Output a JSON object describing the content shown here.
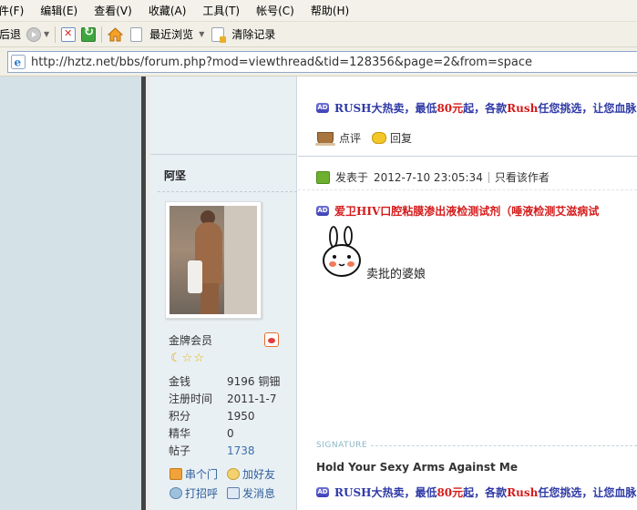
{
  "menu": [
    "件(F)",
    "编辑(E)",
    "查看(V)",
    "收藏(A)",
    "工具(T)",
    "帐号(C)",
    "帮助(H)"
  ],
  "toolbar": {
    "back_label": "后退",
    "recent_label": "最近浏览",
    "clear_label": "清除记录"
  },
  "address": {
    "url": "http://hztz.net/bbs/forum.php?mod=viewthread&tid=128356&page=2&from=space"
  },
  "top_ad": {
    "p1": "RUSH大热卖，最低",
    "p2": "80元",
    "p3": "起，各款",
    "p4": "Rush",
    "p5": "任您挑选，让您血脉"
  },
  "actions": {
    "rate_label": "点评",
    "reply_label": "回复"
  },
  "post": {
    "author": "阿坚",
    "posted_prefix": "发表于",
    "posted_time": "2012-7-10 23:05:34",
    "only_author": "只看该作者"
  },
  "post_ad": {
    "text": "爱卫HIV口腔粘膜渗出液检测试剂（唾液检测艾滋病试"
  },
  "profile": {
    "rank": "金牌会员",
    "stats": [
      {
        "label": "金钱",
        "value": "9196 铜钿"
      },
      {
        "label": "注册时间",
        "value": "2011-1-7"
      },
      {
        "label": "积分",
        "value": "1950"
      },
      {
        "label": "精华",
        "value": "0"
      },
      {
        "label": "帖子",
        "value": "1738"
      }
    ],
    "links": {
      "visit": "串个门",
      "add_friend": "加好友",
      "greet": "打招呼",
      "message": "发消息"
    }
  },
  "content": {
    "text": "卖批的婆娘"
  },
  "signature": {
    "label": "SIGNATURE",
    "text": "Hold Your Sexy Arms Against Me"
  },
  "bottom_ad": {
    "p1": "RUSH大热卖，最低",
    "p2": "80元",
    "p3": "起，各款",
    "p4": "Rush",
    "p5": "任您挑选，让您血脉"
  },
  "colors": {
    "ad_blue": "#2f3aa6",
    "ad_red": "#d51b1b",
    "sidebar_bg": "#e9f0f4",
    "left_bg": "#d4e1e6"
  },
  "icons": [
    "forward-icon",
    "stop-icon",
    "refresh-icon",
    "home-icon",
    "page-icon",
    "clear-icon",
    "ie-icon",
    "ad-icon",
    "cup-icon",
    "comment-bubble-icon",
    "post-icon",
    "weibo-icon",
    "moon-icon",
    "star-icon",
    "house-icon",
    "friend-icon",
    "greet-icon",
    "message-icon",
    "rabbit-emoticon"
  ]
}
